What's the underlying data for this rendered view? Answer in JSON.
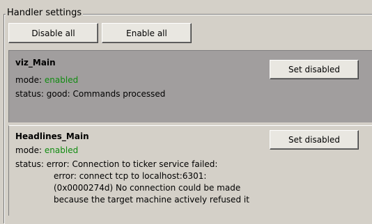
{
  "groupbox": {
    "title": "Handler settings"
  },
  "toolbar": {
    "disable_all": "Disable all",
    "enable_all": "Enable all"
  },
  "handlers": [
    {
      "name": "viz_Main",
      "mode_label": "mode:",
      "mode_value": "enabled",
      "status_label": "status:",
      "status_lines": [
        "good: Commands processed"
      ],
      "button": "Set disabled"
    },
    {
      "name": "Headlines_Main",
      "mode_label": "mode:",
      "mode_value": "enabled",
      "status_label": "status:",
      "status_lines": [
        "error: Connection to ticker service failed:",
        "error: connect tcp to localhost:6301:",
        "(0x0000274d) No connection could be made",
        "because the target machine actively refused it"
      ],
      "button": "Set disabled"
    }
  ],
  "colors": {
    "enabled": "#118c11",
    "panel_active": "#a19e9e",
    "panel_normal": "#d4d0c8"
  }
}
